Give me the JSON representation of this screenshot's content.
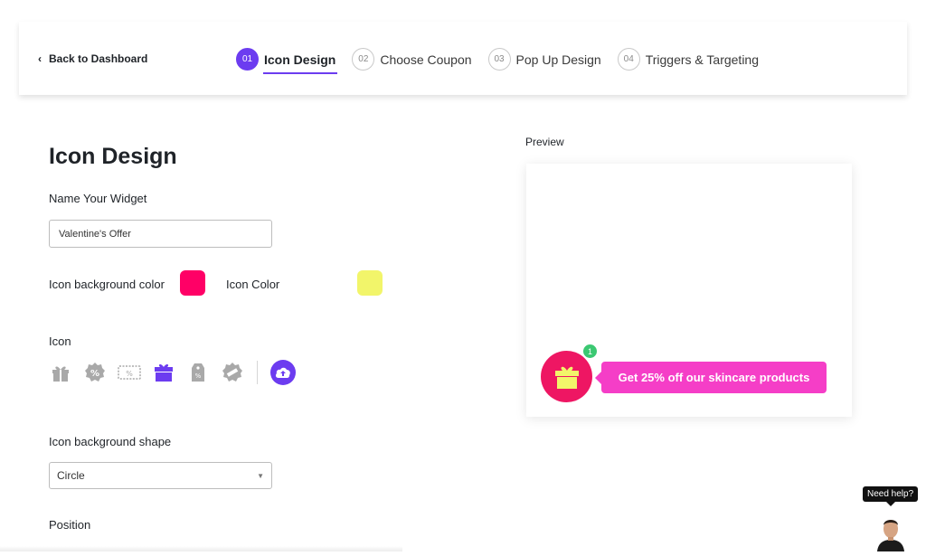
{
  "header": {
    "back_label": "Back to Dashboard",
    "steps": [
      {
        "num": "01",
        "label": "Icon Design"
      },
      {
        "num": "02",
        "label": "Choose Coupon"
      },
      {
        "num": "03",
        "label": "Pop Up Design"
      },
      {
        "num": "04",
        "label": "Triggers & Targeting"
      }
    ],
    "active_step": "01"
  },
  "form": {
    "title": "Icon Design",
    "name_label": "Name Your Widget",
    "name_value": "Valentine's Offer",
    "icon_bg_color_label": "Icon background color",
    "icon_bg_color": "#ff0066",
    "icon_color_label": "Icon Color",
    "icon_color": "#f2f56a",
    "icon_label": "Icon",
    "icon_options": [
      "gift-icon",
      "percent-badge-icon",
      "coupon-icon",
      "gift-box-icon",
      "price-tag-icon",
      "sale-badge-icon"
    ],
    "selected_icon": "gift-box-icon",
    "shape_label": "Icon background shape",
    "shape_value": "Circle",
    "position_label": "Position"
  },
  "preview": {
    "label": "Preview",
    "badge_count": "1",
    "message": "Get 25% off our skincare products",
    "widget_bg_color": "#ee1663",
    "bubble_color": "#f53ec7"
  },
  "help": {
    "label": "Need help?"
  },
  "colors": {
    "accent": "#6c3cf0",
    "badge": "#3bc872"
  }
}
